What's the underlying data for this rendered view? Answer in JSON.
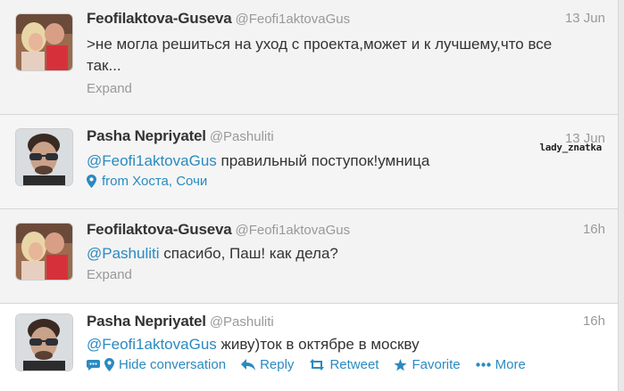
{
  "colors": {
    "link": "#2a8ac0",
    "text": "#333333",
    "muted": "#999999"
  },
  "tweets": [
    {
      "name": "Feofilaktova-Guseva",
      "handle": "@Feofi1aktovaGus",
      "time": "13 Jun",
      "text_line1": ">не могла решиться на уход с проекта,может и к лучшему,что все",
      "text_line2": "так...",
      "expand": "Expand",
      "avatar_icon": "avatar-couple-photo"
    },
    {
      "name": "Pasha Nepriyatel",
      "handle": "@Pashuliti",
      "time": "13 Jun",
      "mention": "@Feofi1aktovaGus",
      "text": " правильный поступок!умница",
      "location": "from Хоста, Сочи",
      "location_icon": "map-pin-icon",
      "watermark": "lady_znatka",
      "avatar_icon": "avatar-man-sunglasses"
    },
    {
      "name": "Feofilaktova-Guseva",
      "handle": "@Feofi1aktovaGus",
      "time": "16h",
      "mention": "@Pashuliti",
      "text": " спасибо, Паш! как дела?",
      "expand": "Expand",
      "avatar_icon": "avatar-couple-photo"
    },
    {
      "name": "Pasha Nepriyatel",
      "handle": "@Pashuliti",
      "time": "16h",
      "mention": "@Feofi1aktovaGus",
      "text": " живу)ток в октябре в москву",
      "avatar_icon": "avatar-man-sunglasses",
      "actions": {
        "hide_conversation": "Hide conversation",
        "reply": "Reply",
        "retweet": "Retweet",
        "favorite": "Favorite",
        "more": "More"
      }
    }
  ]
}
